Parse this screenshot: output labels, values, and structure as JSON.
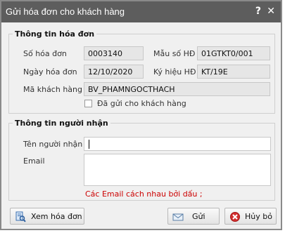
{
  "window": {
    "title": "Gửi hóa đơn cho khách hàng",
    "help_glyph": "?",
    "close_glyph": "✕"
  },
  "invoice_group": {
    "legend": "Thông tin hóa đơn",
    "invoice_no_label": "Số hóa đơn",
    "invoice_no_value": "0003140",
    "template_label": "Mẫu số HĐ",
    "template_value": "01GTKT0/001",
    "date_label": "Ngày hóa đơn",
    "date_value": "12/10/2020",
    "symbol_label": "Ký hiệu HĐ",
    "symbol_value": "KT/19E",
    "customer_label": "Mã khách hàng",
    "customer_value": "BV_PHAMNGOCTHACH",
    "sent_checkbox_label": "Đã gửi cho khách hàng"
  },
  "recipient_group": {
    "legend": "Thông tin người nhận",
    "name_label": "Tên người nhận",
    "name_value": "",
    "email_label": "Email",
    "email_value": "",
    "email_note": "Các Email cách nhau bởi dấu ;"
  },
  "buttons": {
    "view_label": "Xem hóa đơn",
    "send_label": "Gửi",
    "cancel_label": "Hủy bỏ"
  }
}
